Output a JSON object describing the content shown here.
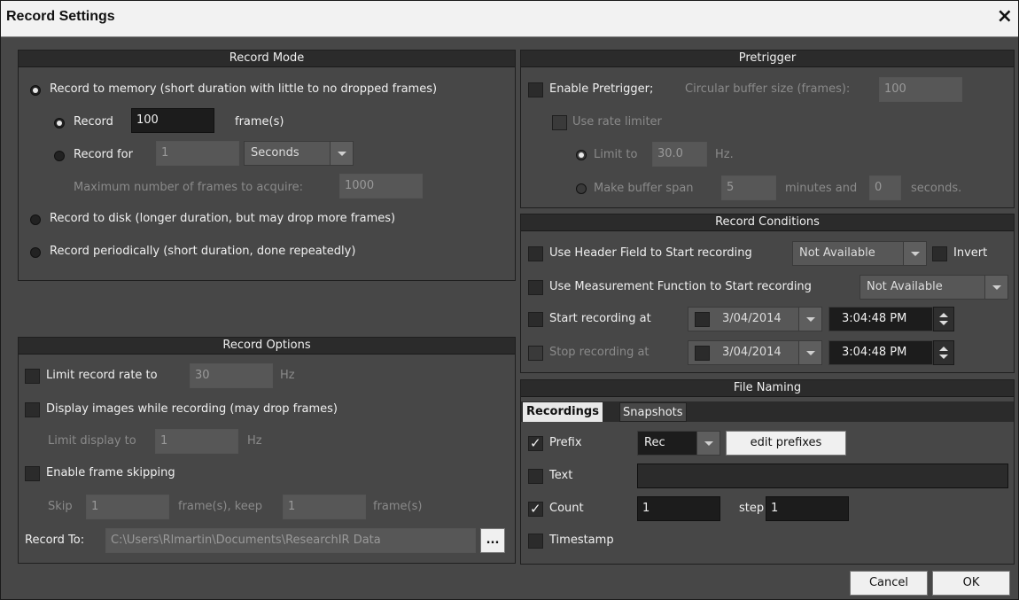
{
  "window": {
    "title": "Record Settings",
    "close": "×"
  },
  "record_mode": {
    "header": "Record Mode",
    "opt_memory": "Record to memory (short duration with little to no dropped frames)",
    "opt_record": "Record",
    "record_frames": "100",
    "frames_unit": "frame(s)",
    "opt_record_for": "Record for",
    "record_for_value": "1",
    "record_for_unit": "Seconds",
    "max_frames_label": "Maximum number of frames to acquire:",
    "max_frames_value": "1000",
    "opt_disk": "Record to disk (longer duration, but may drop more frames)",
    "opt_periodic": "Record periodically (short duration, done repeatedly)"
  },
  "record_options": {
    "header": "Record Options",
    "limit_rate_label": "Limit record rate to",
    "limit_rate_value": "30",
    "limit_rate_unit": "Hz",
    "display_images_label": "Display images while recording (may drop frames)",
    "limit_display_label": "Limit display to",
    "limit_display_value": "1",
    "limit_display_unit": "Hz",
    "frame_skipping_label": "Enable frame skipping",
    "skip_label": "Skip",
    "skip_value": "1",
    "keep_label": "frame(s), keep",
    "keep_value": "1",
    "keep_unit": "frame(s)",
    "record_to_label": "Record To:",
    "record_to_path": "C:\\Users\\Rlmartin\\Documents\\ResearchIR Data",
    "browse_label": "..."
  },
  "pretrigger": {
    "header": "Pretrigger",
    "enable_label": "Enable Pretrigger;",
    "buffer_label": "Circular buffer size (frames):",
    "buffer_value": "100",
    "rate_limiter_label": "Use rate limiter",
    "limit_to_label": "Limit to",
    "limit_to_value": "30.0",
    "limit_to_unit": "Hz.",
    "buffer_span_label": "Make buffer span",
    "span_minutes": "5",
    "minutes_and": "minutes and",
    "span_seconds": "0",
    "seconds": "seconds."
  },
  "record_conditions": {
    "header": "Record Conditions",
    "header_field_label": "Use Header Field to Start recording",
    "header_field_value": "Not Available",
    "invert_label": "Invert",
    "measurement_label": "Use Measurement Function to Start recording",
    "measurement_value": "Not Available",
    "start_label": "Start recording at",
    "start_date": "3/04/2014",
    "start_time": "3:04:48 PM",
    "stop_label": "Stop recording at",
    "stop_date": "3/04/2014",
    "stop_time": "3:04:48 PM"
  },
  "file_naming": {
    "header": "File Naming",
    "tab_recordings": "Recordings",
    "tab_snapshots": "Snapshots",
    "prefix_label": "Prefix",
    "prefix_value": "Rec",
    "edit_prefixes": "edit prefixes",
    "text_label": "Text",
    "text_value": "",
    "count_label": "Count",
    "count_value": "1",
    "step_label": "step",
    "step_value": "1",
    "timestamp_label": "Timestamp"
  },
  "footer": {
    "cancel": "Cancel",
    "ok": "OK"
  }
}
